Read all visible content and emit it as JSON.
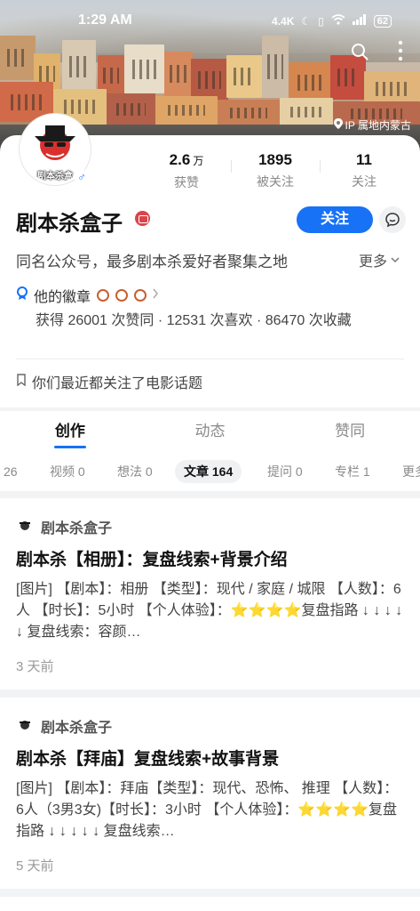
{
  "status_bar": {
    "time": "1:29 AM",
    "network_speed": "4.4K",
    "battery": "62"
  },
  "hero": {
    "ip_location": "IP 属地内蒙古"
  },
  "profile": {
    "avatar_text": "剧本杀盒",
    "gender_symbol": "♂",
    "name": "剧本杀盒子",
    "follow_label": "关注",
    "bio": "同名公众号，最多剧本杀爱好者聚集之地",
    "bio_more": "更多",
    "stats": [
      {
        "value": "2.6",
        "unit": "万",
        "label": "获赞"
      },
      {
        "value": "1895",
        "unit": "",
        "label": "被关注"
      },
      {
        "value": "11",
        "unit": "",
        "label": "关注"
      }
    ],
    "badge_label": "他的徽章",
    "achievement": "获得 26001 次赞同 · 12531 次喜欢 · 86470 次收藏",
    "topic_hint": "你们最近都关注了电影话题"
  },
  "tabs": [
    "创作",
    "动态",
    "赞同"
  ],
  "subtabs": [
    {
      "label": "26"
    },
    {
      "label": "视频 0"
    },
    {
      "label": "想法 0"
    },
    {
      "label": "文章 164"
    },
    {
      "label": "提问 0"
    },
    {
      "label": "专栏 1"
    },
    {
      "label": "更多"
    }
  ],
  "feed": [
    {
      "author": "剧本杀盒子",
      "title": "剧本杀【相册】：复盘线索+背景介绍",
      "excerpt": "[图片] 【剧本】：相册 【类型】：现代 / 家庭 / 城限 【人数】：6人 【时长】：5小时 【个人体验】：⭐⭐⭐⭐复盘指路 ↓ ↓ ↓ ↓ ↓ 复盘线索：容颜…",
      "time": "3 天前"
    },
    {
      "author": "剧本杀盒子",
      "title": "剧本杀【拜庙】复盘线索+故事背景",
      "excerpt": "[图片] 【剧本】：拜庙【类型】：现代、恐怖、 推理 【人数】：6人（3男3女)【时长】：3小时 【个人体验】：⭐⭐⭐⭐复盘指路 ↓ ↓ ↓ ↓ ↓ 复盘线索…",
      "time": "5 天前"
    }
  ],
  "colors": {
    "accent": "#1772f6",
    "verified": "#d9454a",
    "medal": "#c9602d"
  }
}
